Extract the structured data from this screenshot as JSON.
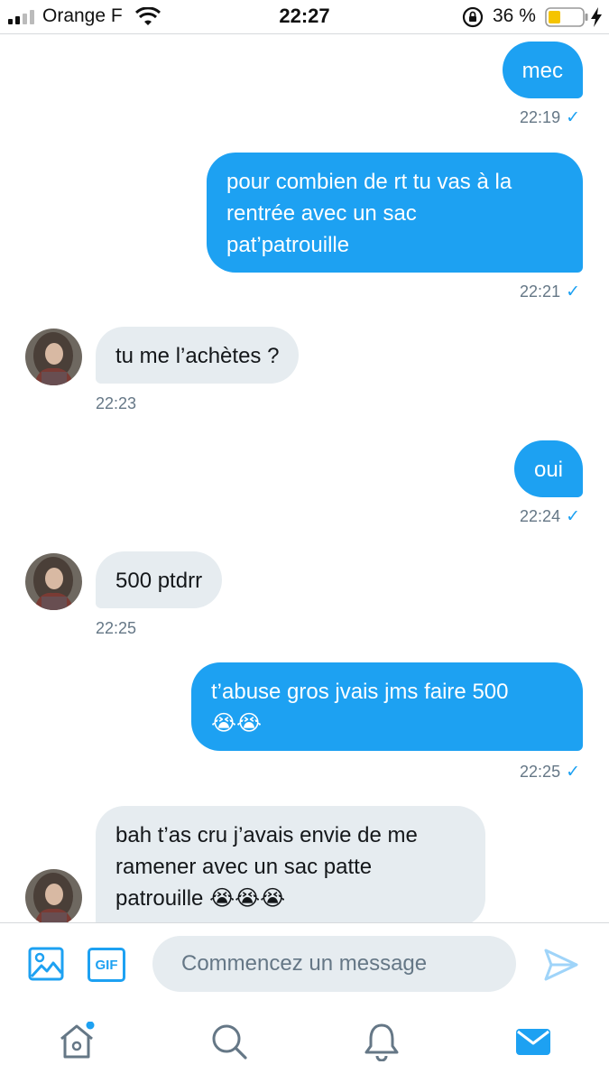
{
  "status_bar": {
    "carrier": "Orange F",
    "time": "22:27",
    "battery_percent": "36 %",
    "battery_level": 0.36,
    "icons": [
      "signal-icon",
      "wifi-icon",
      "rotation-lock-icon",
      "battery-icon",
      "charging-bolt-icon"
    ]
  },
  "messages": [
    {
      "side": "sent",
      "text": "mec",
      "time": "22:19",
      "check": "✓"
    },
    {
      "side": "sent",
      "text": "pour combien de rt tu vas à la\nrentrée avec un sac\npat’patrouille",
      "time": "22:21",
      "check": "✓"
    },
    {
      "side": "received",
      "text": "tu me l’achètes ?",
      "time": "22:23"
    },
    {
      "side": "sent",
      "text": "oui",
      "time": "22:24",
      "check": "✓"
    },
    {
      "side": "received",
      "text": "500 ptdrr",
      "time": "22:25"
    },
    {
      "side": "sent",
      "text": "t’abuse gros jvais jms faire 500\n😭😭",
      "time": "22:25",
      "check": "✓"
    },
    {
      "side": "received",
      "text": "bah t’as cru j’avais envie de me\nramener avec un sac patte\npatrouille 😭😭😭"
    }
  ],
  "composer": {
    "placeholder": "Commencez un message",
    "gif_label": "GIF",
    "icons": [
      "image-icon",
      "gif-icon",
      "send-icon"
    ]
  },
  "tabbar": {
    "icons": [
      "home-icon",
      "search-icon",
      "notifications-icon",
      "messages-icon"
    ],
    "accent": "#1da1f2"
  },
  "colors": {
    "sent_bubble": "#1da1f2",
    "received_bubble": "#e6ecf0",
    "timestamp": "#657786"
  }
}
